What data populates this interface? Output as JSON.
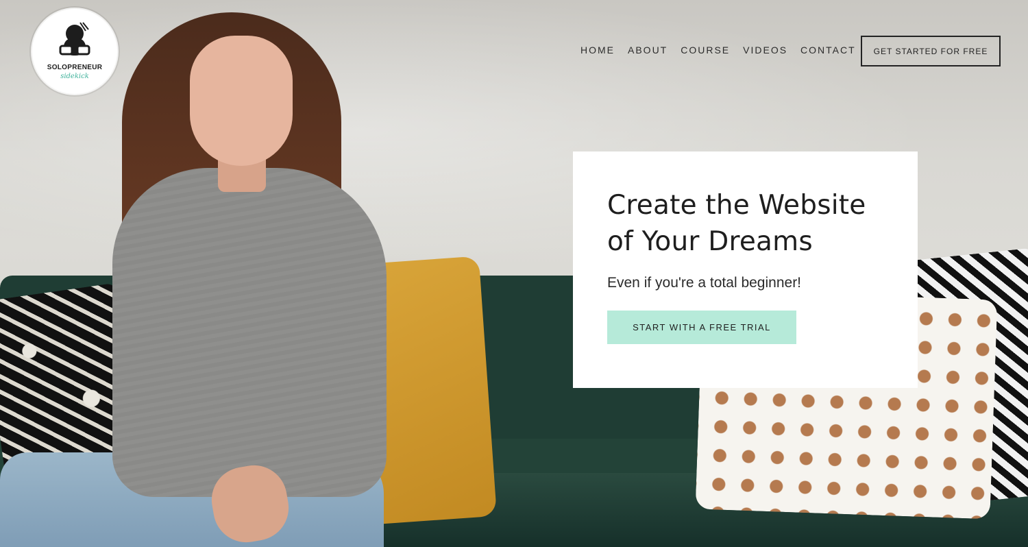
{
  "brand": {
    "name_line_1": "SOLOPRENEUR",
    "name_line_2": "sidekick"
  },
  "nav": {
    "items": [
      {
        "label": "HOME"
      },
      {
        "label": "ABOUT"
      },
      {
        "label": "COURSE"
      },
      {
        "label": "VIDEOS"
      },
      {
        "label": "CONTACT"
      }
    ],
    "cta_label": "GET STARTED FOR FREE"
  },
  "hero": {
    "title": "Create the Website of Your Dreams",
    "subtitle": "Even if you're a total beginner!",
    "button_label": "START WITH A FREE TRIAL"
  },
  "colors": {
    "accent": "#b6ead9",
    "sofa": "#1f3d34",
    "text": "#1e1e1e"
  }
}
